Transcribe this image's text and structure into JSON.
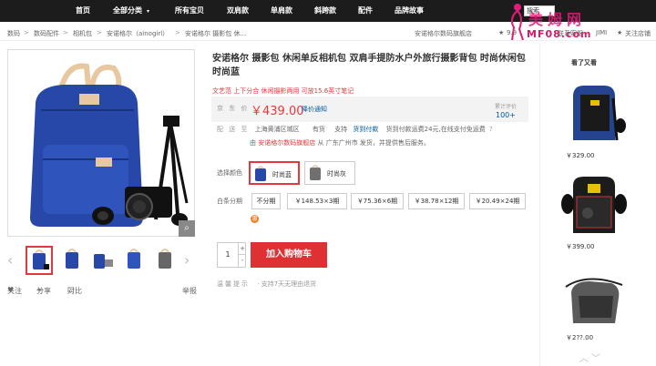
{
  "topnav": {
    "items": [
      "首页",
      "全部分类",
      "所有宝贝",
      "双肩款",
      "单肩款",
      "斜跨款",
      "配件",
      "品牌故事"
    ],
    "chevron": "▾",
    "search_value": "搜索"
  },
  "watermark": {
    "text": "美姆网",
    "url": "MF08.com"
  },
  "breadcrumb": {
    "items": [
      "数码",
      "数码配件",
      "相机包",
      "安诺格尔（ainogirl）",
      "安诺格尔 摄影包 休..."
    ],
    "sep": ">"
  },
  "shop": {
    "name": "安诺格尔数码旗舰店",
    "rating": "9.9",
    "contact": "联系客服",
    "jimi": "JIMI",
    "follow": "关注店铺"
  },
  "gallery": {
    "zoom_icon": "⌕",
    "prev": "‹",
    "next": "›",
    "thumb_count": 6,
    "follow_label": "关注",
    "share_label": "分享",
    "compare_label": "对比",
    "report_label": "举报"
  },
  "product": {
    "title": "安诺格尔 摄影包 休闲单反相机包 双肩手提防水户外旅行摄影背包 时尚休闲包 时尚蓝",
    "subtitle": "文艺范 上下分合 休闲摄影两用 可放15.6英寸笔记",
    "price_label": "京 东 价",
    "price": "￥439.00",
    "price_notify": "降价通知",
    "reviews_label": "累计评价",
    "reviews_count": "100+",
    "delivery_label": "配 送 至",
    "delivery_area": "上海黄浦区城区",
    "delivery_stock": "有货",
    "delivery_support": "支持",
    "delivery_cod": "货到付款",
    "delivery_note": "货到付款运费24元,在线支付免运费",
    "seller_note_prefix": "由",
    "seller_shop": "安诺格尔数码旗舰店",
    "seller_note_suffix": "从 广东广州市 发货，并提供售后服务。",
    "color_label": "选择颜色",
    "colors": [
      {
        "name": "时尚蓝",
        "selected": true,
        "swatch": "#2748a8"
      },
      {
        "name": "时尚灰",
        "selected": false,
        "swatch": "#707070"
      }
    ],
    "installment_label": "白条分期",
    "installments": [
      "不分期",
      "￥148.53×3期",
      "￥75.36×6期",
      "￥38.78×12期",
      "￥20.49×24期"
    ],
    "installment_badge": "惠",
    "quantity": "1",
    "qty_up": "+",
    "qty_down": "-",
    "add_to_cart": "加入购物车",
    "tips_label": "温馨提示",
    "tips_text": "· 支持7天无理由退货"
  },
  "sidebar": {
    "heading": "看了又看",
    "items": [
      {
        "price": "￥329.00"
      },
      {
        "price": "￥399.00"
      },
      {
        "price": "￥2??.00"
      }
    ],
    "arrows": "︿  ﹀"
  },
  "colors": {
    "accent": "#e4393c",
    "cart": "#df3033",
    "link": "#005aa0",
    "nav": "#1c1c1c"
  }
}
